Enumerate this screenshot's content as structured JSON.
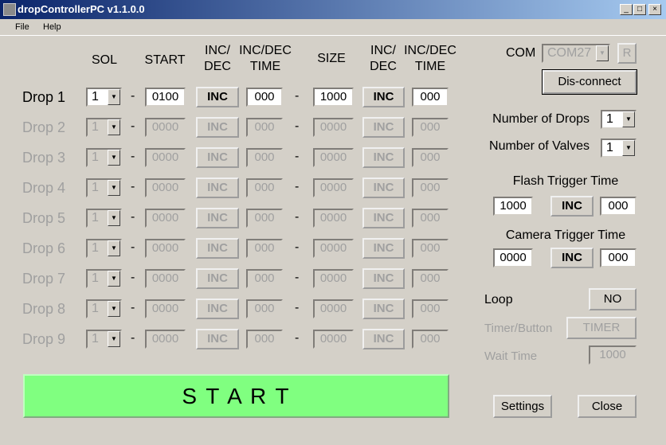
{
  "window": {
    "title": "dropControllerPC v1.1.0.0",
    "minimize": "_",
    "maximize": "□",
    "close": "×"
  },
  "menu": [
    "File",
    "Help"
  ],
  "headers": {
    "sol": "SOL",
    "start": "START",
    "incdec1": "INC/\nDEC",
    "incdec_time1": "INC/DEC\nTIME",
    "size": "SIZE",
    "incdec2": "INC/\nDEC",
    "incdec_time2": "INC/DEC\nTIME"
  },
  "dash": "-",
  "drops": [
    {
      "label": "Drop 1",
      "sol": "1",
      "start": "0100",
      "inc1": "INC",
      "time1": "000",
      "size": "1000",
      "inc2": "INC",
      "time2": "000",
      "enabled": true
    },
    {
      "label": "Drop 2",
      "sol": "1",
      "start": "0000",
      "inc1": "INC",
      "time1": "000",
      "size": "0000",
      "inc2": "INC",
      "time2": "000",
      "enabled": false
    },
    {
      "label": "Drop 3",
      "sol": "1",
      "start": "0000",
      "inc1": "INC",
      "time1": "000",
      "size": "0000",
      "inc2": "INC",
      "time2": "000",
      "enabled": false
    },
    {
      "label": "Drop 4",
      "sol": "1",
      "start": "0000",
      "inc1": "INC",
      "time1": "000",
      "size": "0000",
      "inc2": "INC",
      "time2": "000",
      "enabled": false
    },
    {
      "label": "Drop 5",
      "sol": "1",
      "start": "0000",
      "inc1": "INC",
      "time1": "000",
      "size": "0000",
      "inc2": "INC",
      "time2": "000",
      "enabled": false
    },
    {
      "label": "Drop 6",
      "sol": "1",
      "start": "0000",
      "inc1": "INC",
      "time1": "000",
      "size": "0000",
      "inc2": "INC",
      "time2": "000",
      "enabled": false
    },
    {
      "label": "Drop 7",
      "sol": "1",
      "start": "0000",
      "inc1": "INC",
      "time1": "000",
      "size": "0000",
      "inc2": "INC",
      "time2": "000",
      "enabled": false
    },
    {
      "label": "Drop 8",
      "sol": "1",
      "start": "0000",
      "inc1": "INC",
      "time1": "000",
      "size": "0000",
      "inc2": "INC",
      "time2": "000",
      "enabled": false
    },
    {
      "label": "Drop 9",
      "sol": "1",
      "start": "0000",
      "inc1": "INC",
      "time1": "000",
      "size": "0000",
      "inc2": "INC",
      "time2": "000",
      "enabled": false
    }
  ],
  "com": {
    "label": "COM",
    "port": "COM27",
    "refresh": "R",
    "disconnect": "Dis-connect"
  },
  "num_drops": {
    "label": "Number of Drops",
    "value": "1"
  },
  "num_valves": {
    "label": "Number of Valves",
    "value": "1"
  },
  "flash": {
    "label": "Flash Trigger Time",
    "value": "1000",
    "inc": "INC",
    "step": "000"
  },
  "camera": {
    "label": "Camera Trigger Time",
    "value": "0000",
    "inc": "INC",
    "step": "000"
  },
  "loop": {
    "label": "Loop",
    "value": "NO"
  },
  "timer": {
    "label": "Timer/Button",
    "value": "TIMER"
  },
  "wait": {
    "label": "Wait Time",
    "value": "1000"
  },
  "start_button": "S T A R T",
  "settings": "Settings",
  "close": "Close",
  "colors": {
    "start": "#80ff80",
    "disabled": "#a0a0a0"
  }
}
